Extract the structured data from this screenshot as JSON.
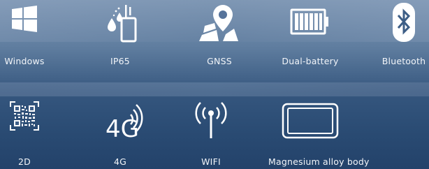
{
  "features": [
    {
      "label": "Windows",
      "icon": "windows-logo-icon"
    },
    {
      "label": "IP65",
      "icon": "water-drop-phone-icon"
    },
    {
      "label": "GNSS",
      "icon": "map-pin-icon"
    },
    {
      "label": "Dual-battery",
      "icon": "battery-icon"
    },
    {
      "label": "Bluetooth",
      "icon": "bluetooth-icon"
    },
    {
      "label": "2D",
      "icon": "qr-code-icon"
    },
    {
      "label": "4G",
      "icon": "4g-signal-icon",
      "icon_text": "4G"
    },
    {
      "label": "WIFI",
      "icon": "wifi-antenna-icon"
    },
    {
      "label": "Magnesium alloy body",
      "icon": "tablet-device-icon"
    }
  ],
  "colors": {
    "icon": "#ffffff",
    "label": "#f2f5f9",
    "background_top": "#7f98b5",
    "background_bottom": "#23426a"
  }
}
